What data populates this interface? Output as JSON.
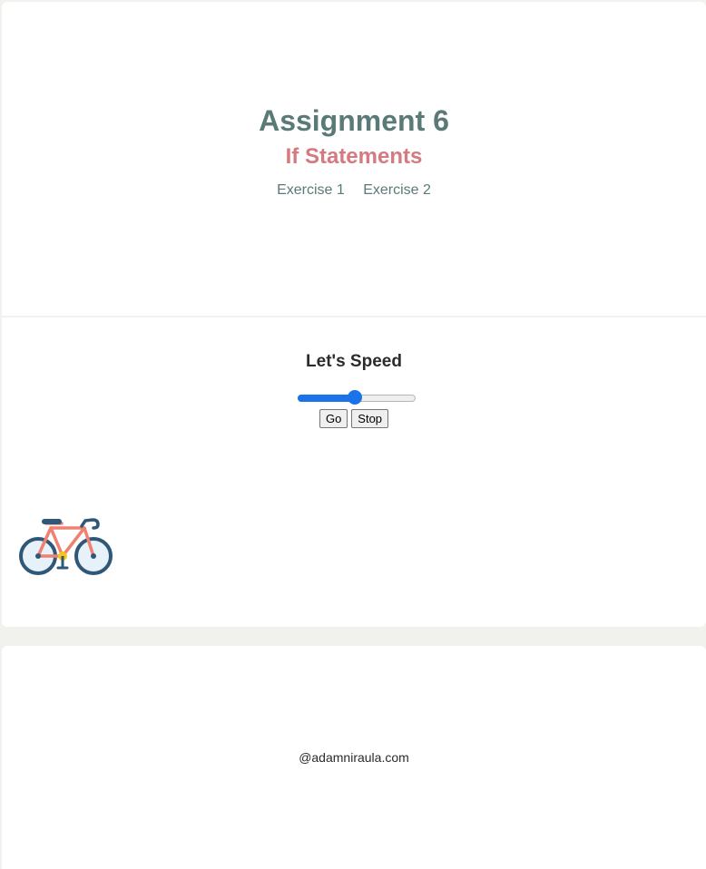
{
  "header": {
    "title": "Assignment 6",
    "subtitle": "If Statements",
    "nav": [
      {
        "label": "Exercise 1"
      },
      {
        "label": "Exercise 2"
      }
    ]
  },
  "main": {
    "heading": "Let's Speed",
    "speed_slider": {
      "value_fraction": 0.49
    },
    "go_label": "Go",
    "stop_label": "Stop",
    "bike_icon": "bicycle-icon"
  },
  "footer": {
    "text": "@adamniraula.com"
  },
  "colors": {
    "page_bg": "#f1f2ee",
    "title": "#5a7a77",
    "subtitle": "#d47a80",
    "slider_accent": "#1a73e8"
  }
}
